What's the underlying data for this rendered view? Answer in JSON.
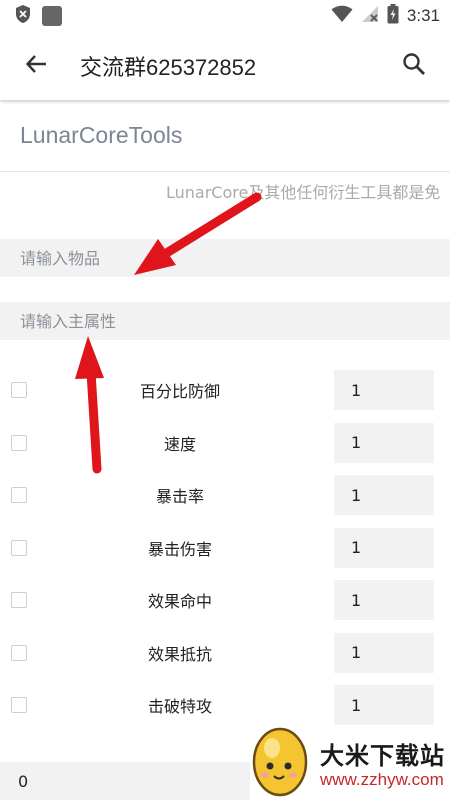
{
  "status_bar": {
    "time": "3:31"
  },
  "app_bar": {
    "title": "交流群625372852"
  },
  "brand": {
    "name": "LunarCoreTools"
  },
  "notice": {
    "text": "LunarCore及其他任何衍生工具都是免"
  },
  "inputs": {
    "item_placeholder": "请输入物品",
    "main_attr_placeholder": "请输入主属性"
  },
  "properties": [
    {
      "label": "百分比防御",
      "value": "1"
    },
    {
      "label": "速度",
      "value": "1"
    },
    {
      "label": "暴击率",
      "value": "1"
    },
    {
      "label": "暴击伤害",
      "value": "1"
    },
    {
      "label": "效果命中",
      "value": "1"
    },
    {
      "label": "效果抵抗",
      "value": "1"
    },
    {
      "label": "击破特攻",
      "value": "1"
    }
  ],
  "bottom": {
    "value": "0"
  },
  "watermark": {
    "title": "大米下载站",
    "url": "www.zzhyw.com"
  },
  "colors": {
    "arrow": "#e0141b",
    "input_bg": "#f2f2f2",
    "brand_text": "#7a8694"
  }
}
